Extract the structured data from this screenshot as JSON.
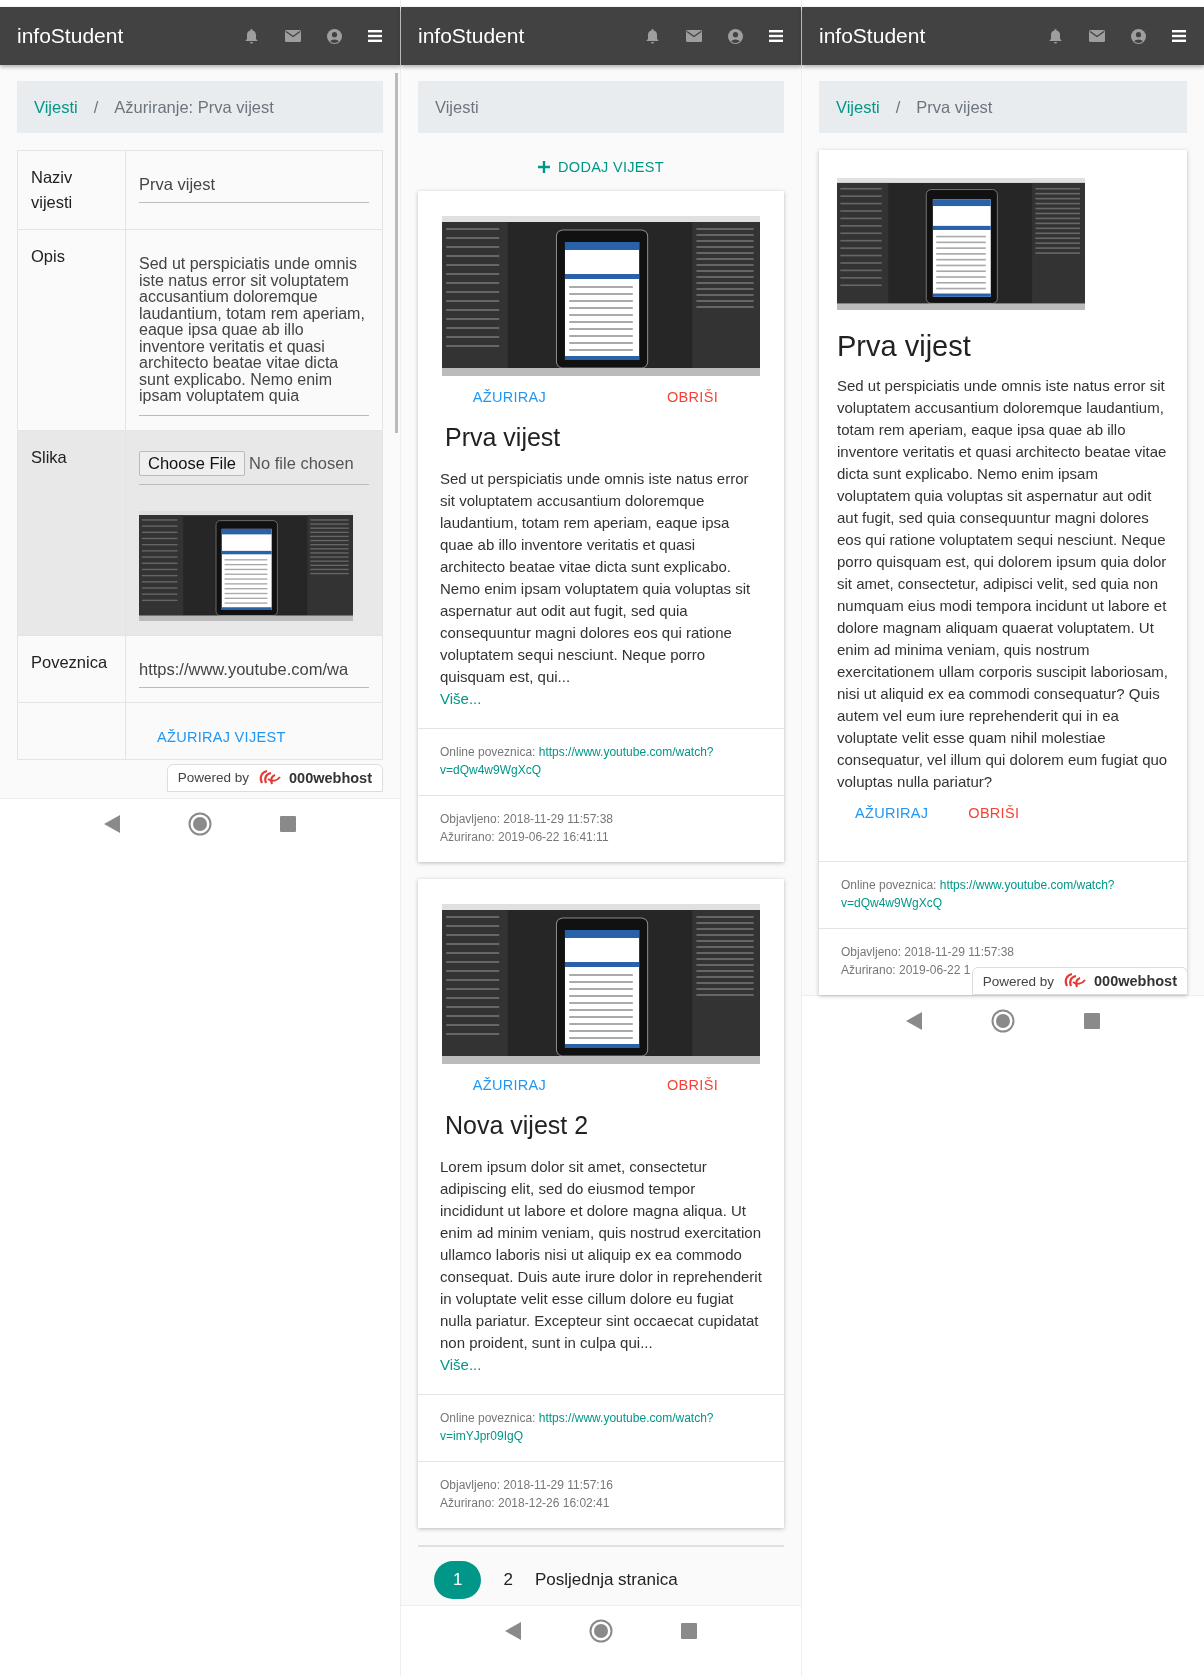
{
  "screens": [
    {
      "kind": "edit",
      "app_title": "infoStudent",
      "breadcrumb_separator": "/",
      "breadcrumb": [
        {
          "label": "Vijesti",
          "link": true
        },
        {
          "label": "Ažuriranje: Prva vijest",
          "link": false
        }
      ],
      "form_rows": [
        {
          "kind": "text",
          "label": "Naziv vijesti",
          "value": "Prva vijest",
          "highlighted": false
        },
        {
          "kind": "textarea",
          "label": "Opis",
          "value": "Sed ut perspiciatis unde omnis iste natus error sit voluptatem accusantium doloremque laudantium, totam rem aperiam, eaque ipsa quae ab illo inventore veritatis et quasi architecto beatae vitae dicta sunt explicabo. Nemo enim ipsam voluptatem quia",
          "highlighted": false
        },
        {
          "kind": "file",
          "label": "Slika",
          "button": "Choose File",
          "status": "No file chosen",
          "highlighted": true
        },
        {
          "kind": "text",
          "label": "Poveznica",
          "value": "https://www.youtube.com/wa",
          "highlighted": false
        },
        {
          "kind": "submit",
          "button": "AŽURIRAJ VIJEST",
          "highlighted": false
        }
      ],
      "hosting_badge": {
        "prefix": "Powered by",
        "brand": "000webhost"
      }
    },
    {
      "kind": "list",
      "app_title": "infoStudent",
      "breadcrumb": [
        {
          "label": "Vijesti",
          "link": false
        }
      ],
      "add_button": "DODAJ VIJEST",
      "cards": [
        {
          "edit": "AŽURIRAJ",
          "delete": "OBRIŠI",
          "title": "Prva vijest",
          "body": "Sed ut perspiciatis unde omnis iste natus error sit voluptatem accusantium doloremque laudantium, totam rem aperiam, eaque ipsa quae ab illo inventore veritatis et quasi architecto beatae vitae dicta sunt explicabo. Nemo enim ipsam voluptatem quia voluptas sit aspernatur aut odit aut fugit, sed quia consequuntur magni dolores eos qui ratione voluptatem sequi nesciunt. Neque porro quisquam est, qui...",
          "more": "Više...",
          "link_label": "Online poveznica:",
          "link_lines": [
            "https://www.youtube.com/watch?",
            "v=dQw4w9WgXcQ"
          ],
          "published": "Objavljeno: 2018-11-29 11:57:38",
          "updated": "Ažurirano: 2019-06-22 16:41:11"
        },
        {
          "edit": "AŽURIRAJ",
          "delete": "OBRIŠI",
          "title": "Nova vijest 2",
          "body": "Lorem ipsum dolor sit amet, consectetur adipiscing elit, sed do eiusmod tempor incididunt ut labore et dolore magna aliqua. Ut enim ad minim veniam, quis nostrud exercitation ullamco laboris nisi ut aliquip ex ea commodo consequat. Duis aute irure dolor in reprehenderit in voluptate velit esse cillum dolore eu fugiat nulla pariatur. Excepteur sint occaecat cupidatat non proident, sunt in culpa qui...",
          "more": "Više...",
          "link_label": "Online poveznica:",
          "link_lines": [
            "https://www.youtube.com/watch?",
            "v=imYJpr09IgQ"
          ],
          "published": "Objavljeno: 2018-11-29 11:57:16",
          "updated": "Ažurirano: 2018-12-26 16:02:41"
        }
      ],
      "pagination": [
        {
          "label": "1",
          "selected": true
        },
        {
          "label": "2",
          "selected": false
        },
        {
          "label": "Posljednja stranica",
          "selected": false
        }
      ]
    },
    {
      "kind": "detail",
      "app_title": "infoStudent",
      "breadcrumb_separator": "/",
      "breadcrumb": [
        {
          "label": "Vijesti",
          "link": true
        },
        {
          "label": "Prva vijest",
          "link": false
        }
      ],
      "article": {
        "title": "Prva vijest",
        "body": "Sed ut perspiciatis unde omnis iste natus error sit voluptatem accusantium doloremque laudantium, totam rem aperiam, eaque ipsa quae ab illo inventore veritatis et quasi architecto beatae vitae dicta sunt explicabo. Nemo enim ipsam voluptatem quia voluptas sit aspernatur aut odit aut fugit, sed quia consequuntur magni dolores eos qui ratione voluptatem sequi nesciunt. Neque porro quisquam est, qui dolorem ipsum quia dolor sit amet, consectetur, adipisci velit, sed quia non numquam eius modi tempora incidunt ut labore et dolore magnam aliquam quaerat voluptatem. Ut enim ad minima veniam, quis nostrum exercitationem ullam corporis suscipit laboriosam, nisi ut aliquid ex ea commodi consequatur? Quis autem vel eum iure reprehenderit qui in ea voluptate velit esse quam nihil molestiae consequatur, vel illum qui dolorem eum fugiat quo voluptas nulla pariatur?",
        "edit": "AŽURIRAJ",
        "delete": "OBRIŠI",
        "link_label": "Online poveznica:",
        "link_lines": [
          "https://www.youtube.com/watch?",
          "v=dQw4w9WgXcQ"
        ],
        "published": "Objavljeno: 2018-11-29 11:57:38",
        "updated": "Ažurirano: 2019-06-22 1"
      },
      "hosting_badge": {
        "prefix": "Powered by",
        "brand": "000webhost"
      }
    }
  ]
}
